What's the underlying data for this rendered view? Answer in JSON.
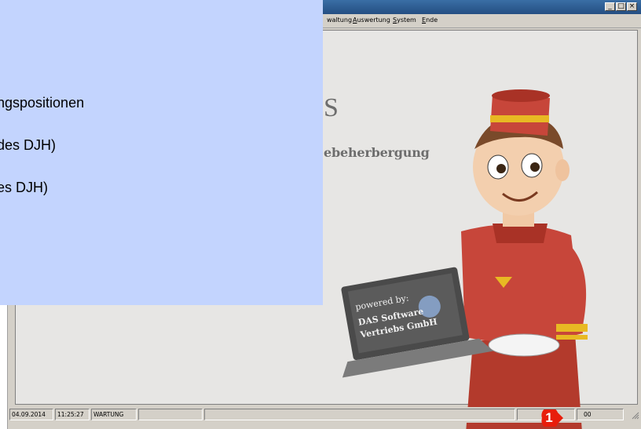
{
  "window": {
    "controls": {
      "minimize": "_",
      "maximize": "□",
      "close": "×"
    }
  },
  "menu": {
    "items": [
      {
        "label": "waltung",
        "access_key": ""
      },
      {
        "label": "uswertung",
        "access_key": "A"
      },
      {
        "label": "ystem",
        "access_key": "S"
      },
      {
        "label": "nde",
        "access_key": "E"
      }
    ]
  },
  "splash": {
    "brand_letter": "S",
    "tagline": "ebeherbergung",
    "laptop_text": [
      "powered by:",
      "DAS Software",
      "Vertriebs GmbH"
    ]
  },
  "status_bar": {
    "date": "04.09.2014",
    "time": "11:25:27",
    "mode": "WARTUNG",
    "value": "00"
  },
  "overlay": {
    "lines": [
      "ngspositionen",
      "des DJH)",
      "es DJH)"
    ]
  },
  "marker": {
    "number": "1",
    "color": "#e81e0c"
  },
  "colors": {
    "overlay": "#c3d4fe",
    "uniform": "#c0392b",
    "cap_band": "#e8b923"
  }
}
